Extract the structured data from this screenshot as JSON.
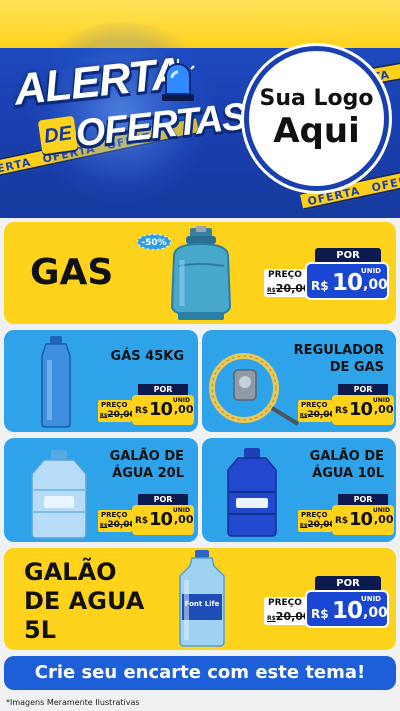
{
  "header": {
    "title_line1": "ALERTA",
    "title_connector": "DE",
    "title_line2": "OFERTAS",
    "stripe_text": "OFERTA",
    "logo_line1": "Sua Logo",
    "logo_line2": "Aqui"
  },
  "featured_top": {
    "name": "GAS",
    "discount_badge": "-50%",
    "price_label": "PREÇO",
    "old_price": "20,00",
    "old_currency": "R$",
    "por_label": "POR",
    "unit_label": "UNID",
    "currency": "R$",
    "price_int": "10",
    "price_cents": ",00"
  },
  "grid": [
    {
      "name_line1": "GÁS 45KG",
      "name_line2": "",
      "price_label": "PREÇO",
      "old_currency": "R$",
      "old_price": "20,00",
      "por_label": "POR",
      "unit_label": "UNID",
      "currency": "R$",
      "price_int": "10",
      "price_cents": ",00"
    },
    {
      "name_line1": "REGULADOR",
      "name_line2": "DE GAS",
      "price_label": "PREÇO",
      "old_currency": "R$",
      "old_price": "20,00",
      "por_label": "POR",
      "unit_label": "UNID",
      "currency": "R$",
      "price_int": "10",
      "price_cents": ",00"
    },
    {
      "name_line1": "GALÃO DE",
      "name_line2": "ÁGUA 20L",
      "price_label": "PREÇO",
      "old_currency": "R$",
      "old_price": "20,00",
      "por_label": "POR",
      "unit_label": "UNID",
      "currency": "R$",
      "price_int": "10",
      "price_cents": ",00"
    },
    {
      "name_line1": "GALÃO DE",
      "name_line2": "ÁGUA 10L",
      "price_label": "PREÇO",
      "old_currency": "R$",
      "old_price": "20,00",
      "por_label": "POR",
      "unit_label": "UNID",
      "currency": "R$",
      "price_int": "10",
      "price_cents": ",00"
    }
  ],
  "featured_bottom": {
    "name_line1": "GALÃO",
    "name_line2": "DE AGUA",
    "name_line3": "5L",
    "bottle_brand": "Font Life",
    "price_label": "PREÇO",
    "old_currency": "R$",
    "old_price": "20,00",
    "por_label": "POR",
    "unit_label": "UNID",
    "currency": "R$",
    "price_int": "10",
    "price_cents": ",00"
  },
  "cta": {
    "label": "Crie seu encarte com este tema!"
  },
  "footnote": "*Imagens Meramente Ilustrativas",
  "colors": {
    "yellow": "#ffd21c",
    "blue_card": "#2ea3ea",
    "header_blue": "#1a3fae",
    "price_blue": "#1a46d4",
    "navy": "#0c1a4e"
  }
}
